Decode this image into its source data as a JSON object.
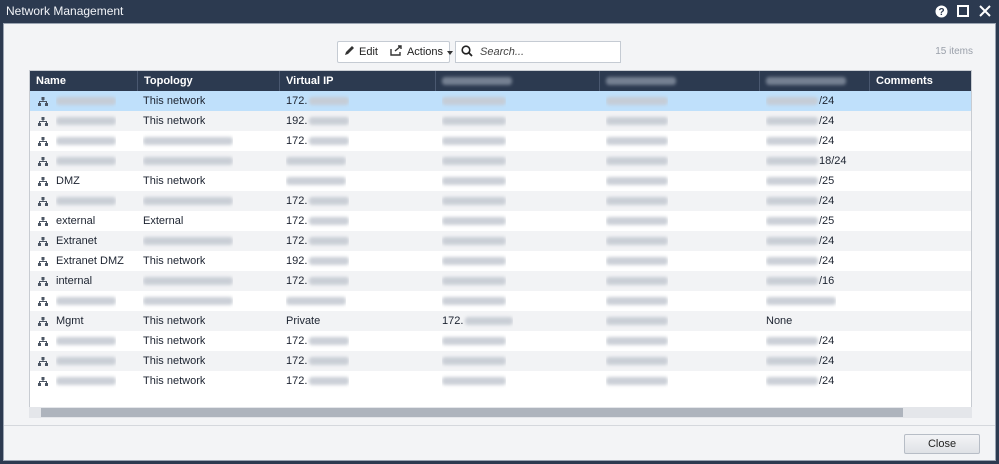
{
  "window": {
    "title": "Network Management"
  },
  "toolbar": {
    "edit_label": "Edit",
    "actions_label": "Actions",
    "search_placeholder": "Search...",
    "count_text": "15 items"
  },
  "grid": {
    "columns": [
      "Name",
      "Topology",
      "Virtual IP",
      "",
      "",
      "",
      "Comments"
    ],
    "rows": [
      {
        "name": "",
        "topology": "This network",
        "vip": "172.",
        "c4": "",
        "c5": "",
        "c6": "/24",
        "selected": true
      },
      {
        "name": "",
        "topology": "This network",
        "vip": "192.",
        "c4": "",
        "c5": "",
        "c6": "/24"
      },
      {
        "name": "",
        "topology": "",
        "vip": "172.",
        "c4": "",
        "c5": "",
        "c6": "/24"
      },
      {
        "name": "",
        "topology": "",
        "vip": "",
        "c4": "",
        "c5": "",
        "c6": "18/24"
      },
      {
        "name": "DMZ",
        "topology": "This network",
        "vip": "",
        "c4": "",
        "c5": "",
        "c6": "/25"
      },
      {
        "name": "",
        "topology": "",
        "vip": "172.",
        "c4": "",
        "c5": "",
        "c6": "/24"
      },
      {
        "name": "external",
        "topology": "External",
        "vip": "172.",
        "c4": "",
        "c5": "",
        "c6": "/25"
      },
      {
        "name": "Extranet",
        "topology": "",
        "vip": "172.",
        "c4": "",
        "c5": "",
        "c6": "/24"
      },
      {
        "name": "Extranet DMZ",
        "topology": "This network",
        "vip": "192.",
        "c4": "",
        "c5": "",
        "c6": "/24"
      },
      {
        "name": "internal",
        "topology": "",
        "vip": "172.",
        "c4": "",
        "c5": "",
        "c6": "/16"
      },
      {
        "name": "",
        "topology": "",
        "vip": "",
        "c4": "",
        "c5": "",
        "c6": ""
      },
      {
        "name": "Mgmt",
        "topology": "This network",
        "vip": "Private",
        "c4": "172.",
        "c5": "",
        "c6": "None"
      },
      {
        "name": "",
        "topology": "This network",
        "vip": "172.",
        "c4": "",
        "c5": "",
        "c6": "/24"
      },
      {
        "name": "",
        "topology": "This network",
        "vip": "172.",
        "c4": "",
        "c5": "",
        "c6": "/24"
      },
      {
        "name": "",
        "topology": "This network",
        "vip": "172.",
        "c4": "",
        "c5": "",
        "c6": "/24"
      }
    ]
  },
  "footer": {
    "close_label": "Close"
  },
  "icons": [
    "help-icon",
    "maximize-icon",
    "close-icon",
    "edit-icon",
    "actions-icon",
    "search-icon",
    "network-icon"
  ]
}
